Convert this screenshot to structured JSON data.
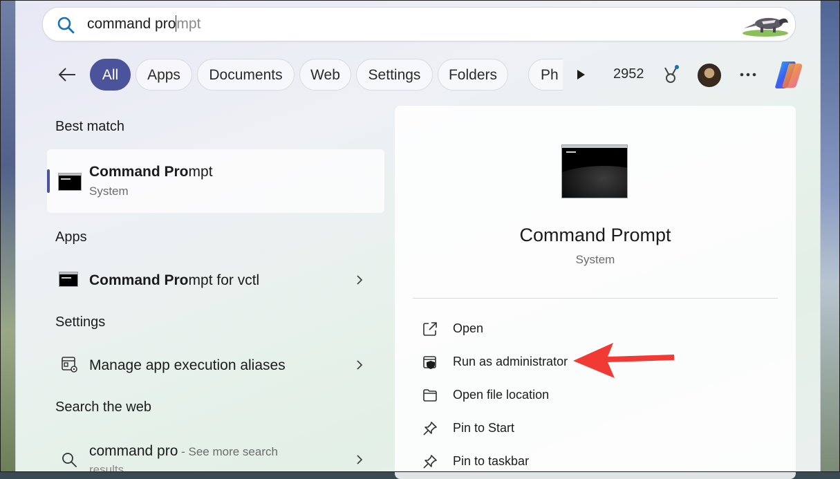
{
  "search": {
    "typed": "command pro",
    "suggestion": "mpt"
  },
  "filters": {
    "chips": [
      "All",
      "Apps",
      "Documents",
      "Web",
      "Settings",
      "Folders",
      "Ph"
    ],
    "active": "All"
  },
  "header": {
    "points": "2952"
  },
  "left": {
    "best_match_title": "Best match",
    "best_match": {
      "name_bold": "Command Pro",
      "name_rest": "mpt",
      "sub": "System"
    },
    "apps_title": "Apps",
    "apps_item": {
      "name_bold": "Command Pro",
      "name_rest": "mpt for vctl"
    },
    "settings_title": "Settings",
    "settings_item": "Manage app execution aliases",
    "web_title": "Search the web",
    "web_item": {
      "query": "command pro",
      "sub": " - See more search",
      "sub_cont": "results"
    }
  },
  "preview": {
    "title": "Command Prompt",
    "sub": "System",
    "actions": [
      "Open",
      "Run as administrator",
      "Open file location",
      "Pin to Start",
      "Pin to taskbar"
    ]
  },
  "colors": {
    "accent": "#4b539b",
    "arrow": "#f23a35"
  }
}
